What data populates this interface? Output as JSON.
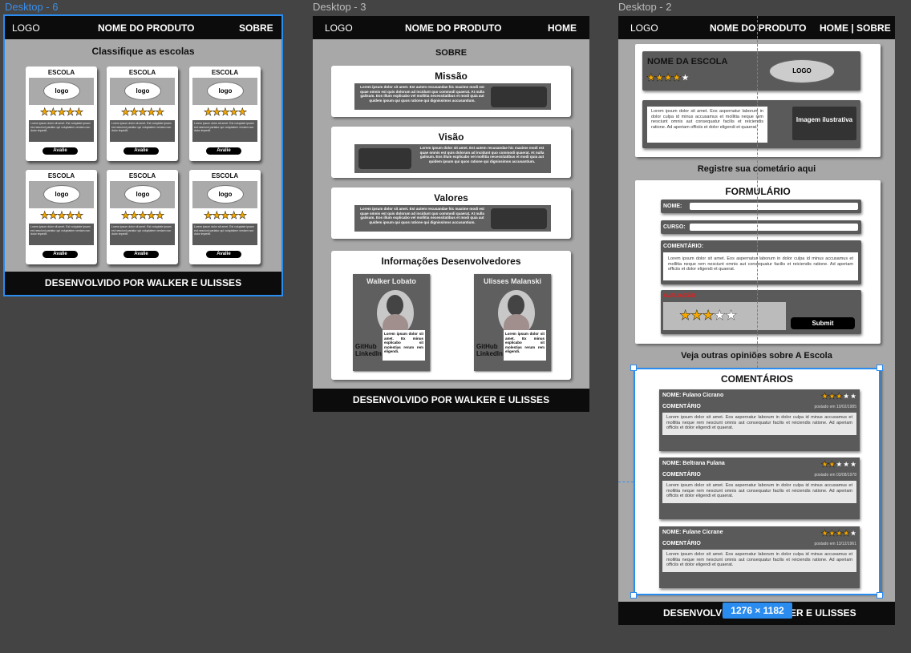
{
  "frames": {
    "desktop6": {
      "label": "Desktop - 6",
      "nav": {
        "logo": "LOGO",
        "product": "NOME DO PRODUTO",
        "link": "SOBRE"
      },
      "heading": "Classifique as escolas",
      "card": {
        "title": "ESCOLA",
        "logo": "logo",
        "stars": "★★★★★",
        "desc": "Lorem ipsum dolor sit amet. Est voluptate ipsam est nesciunt pariatur qui voluptatem veniam non dolor impedit.",
        "button": "Avalie"
      },
      "footer": "DESENVOLVIDO POR WALKER E ULISSES"
    },
    "desktop3": {
      "label": "Desktop - 3",
      "nav": {
        "logo": "LOGO",
        "product": "NOME DO PRODUTO",
        "link": "HOME"
      },
      "heading": "SOBRE",
      "sections": [
        "Missão",
        "Visão",
        "Valores"
      ],
      "lorem": "Lorem ipsum dolor sit amet. Est autem recusandae hic maxime modi est quae omnis est quis dolorum ad incidunt quo commodi quaerat. At nulla galisum. Eos illum explicabo vel mollitia necessitatibus et modi quia aut quidem ipsum qui quos ratione qui dignissimos accusantium.",
      "devs_title": "Informações Desenvolvedores",
      "devs": [
        {
          "name": "Walker Lobato",
          "github": "GitHub",
          "linkedin": "LinkedIn",
          "text": "Lorem ipsum dolor sit amet. Ex minus explicabo sit molestias rerum rem eligendi."
        },
        {
          "name": "Ulisses Malanski",
          "github": "GitHub",
          "linkedin": "LinkedIn",
          "text": "Lorem ipsum dolor sit amet. Ex minus explicabo sit molestias rerum rem eligendi."
        }
      ],
      "footer": "DESENVOLVIDO POR WALKER E ULISSES"
    },
    "desktop2": {
      "label": "Desktop - 2",
      "nav": {
        "logo": "LOGO",
        "product": "NOME DO PRODUTO",
        "link": "HOME | SOBRE"
      },
      "school": {
        "name": "NOME DA ESCOLA",
        "logo": "LOGO",
        "stars": "★★★★",
        "empty_stars": "★",
        "desc": "Lorem ipsum dolor sit amet. Eos aspernatur laborum in dolor culpa id minus accusamus et mollitia neque rem nesciunt omnis aut consequatur facilis et reiciendis ratione. Ad aperiam officiis et dolor eligendi et quaerat.",
        "image": "Imagem ilustrativa"
      },
      "register_heading": "Registre sua cometário aqui",
      "form": {
        "title": "FORMULÁRIO",
        "name_label": "NOME:",
        "course_label": "CURSO:",
        "comment_label": "COMENTÁRIO:",
        "comment_text": "Lorem ipsum dolor sit amet. Eos aspernatur laborum in dolor culpa id minus accusamus et mollitia neque rem nesciunt omnis aut consequatur facilis et reiciendis ratione. Ad aperiam officiis et dolor eligendi et quaerat.",
        "rating_label": "AVALIAÇÃO",
        "rating_value": 3,
        "submit": "Submit"
      },
      "opinions_heading": "Veja  outras opiniões sobre A Escola",
      "comments_title": "COMENTÁRIOS",
      "comments": [
        {
          "name": "NOME: Fulano Cicrano",
          "label": "COMENTÁRIO",
          "date": "postado em 10/02/1985",
          "rating": 3,
          "text": "Lorem ipsum dolor sit amet. Eos aspernatur laborum in dolor culpa id minus accusamus et mollitia neque rem nesciunt omnis aut consequatur facilis et reiciendis ratione. Ad aperiam officiis et dolor eligendi et quaerat."
        },
        {
          "name": "NOME: Beltrana Fulana",
          "label": "COMENTÁRIO",
          "date": "postado em 03/08/1978",
          "rating": 2,
          "text": "Lorem ipsum dolor sit amet. Eos aspernatur laborum in dolor culpa id minus accusamus et mollitia neque rem nesciunt omnis aut consequatur facilis et reiciendis ratione. Ad aperiam officiis et dolor eligendi et quaerat."
        },
        {
          "name": "NOME: Fulane Cicrane",
          "label": "COMENTÁRIO",
          "date": "postado em 13/12/1961",
          "rating": 4,
          "text": "Lorem ipsum dolor sit amet. Eos aspernatur laborum in dolor culpa id minus accusamus et mollitia neque rem nesciunt omnis aut consequatur facilis et reiciendis ratione. Ad aperiam officiis et dolor eligendi et quaerat."
        }
      ],
      "footer_left": "DESENVOLVI",
      "footer_right": "ER E ULISSES",
      "selection_size": "1276 × 1182"
    }
  },
  "colors": {
    "canvas": "#444444",
    "frame_bg": "#a8a8a8",
    "selection": "#2b8cf0",
    "star": "#f5a800",
    "rating_label": "#e02020"
  }
}
